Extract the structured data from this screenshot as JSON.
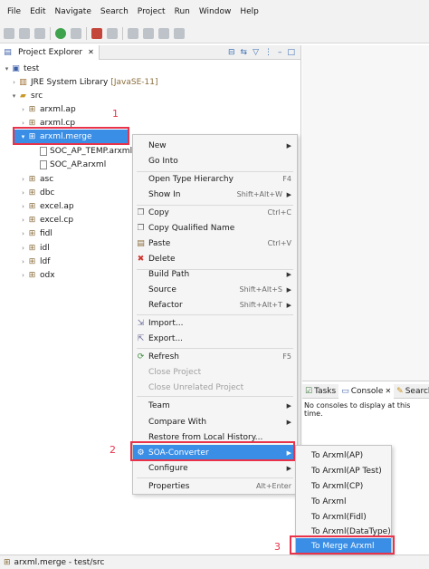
{
  "menu": [
    "File",
    "Edit",
    "Navigate",
    "Search",
    "Project",
    "Run",
    "Window",
    "Help"
  ],
  "explorer": {
    "tab_label": "Project Explorer",
    "close": "✕",
    "tree": [
      {
        "label": "test",
        "icon": "project-folder-icon"
      },
      {
        "label": "JRE System Library",
        "suffix": "[JavaSE-11]",
        "icon": "library-icon"
      },
      {
        "label": "src",
        "icon": "source-folder-icon"
      },
      {
        "label": "arxml.ap",
        "icon": "package-icon"
      },
      {
        "label": "arxml.cp",
        "icon": "package-icon"
      },
      {
        "label": "arxml.merge",
        "icon": "package-icon"
      },
      {
        "label": "SOC_AP_TEMP.arxml",
        "icon": "file-icon"
      },
      {
        "label": "SOC_AP.arxml",
        "icon": "file-icon"
      },
      {
        "label": "asc",
        "icon": "package-icon"
      },
      {
        "label": "dbc",
        "icon": "package-icon"
      },
      {
        "label": "excel.ap",
        "icon": "package-icon"
      },
      {
        "label": "excel.cp",
        "icon": "package-icon"
      },
      {
        "label": "fidl",
        "icon": "package-icon"
      },
      {
        "label": "idl",
        "icon": "package-icon"
      },
      {
        "label": "ldf",
        "icon": "package-icon"
      },
      {
        "label": "odx",
        "icon": "package-icon"
      }
    ]
  },
  "context_menu": [
    {
      "label": "New",
      "submenu": true
    },
    {
      "label": "Go Into"
    },
    {
      "label": "Open Type Hierarchy",
      "accel": "F4"
    },
    {
      "label": "Show In",
      "accel": "Shift+Alt+W",
      "submenu": true
    },
    {
      "label": "Copy",
      "accel": "Ctrl+C"
    },
    {
      "label": "Copy Qualified Name"
    },
    {
      "label": "Paste",
      "accel": "Ctrl+V"
    },
    {
      "label": "Delete"
    },
    {
      "label": "Build Path",
      "submenu": true
    },
    {
      "label": "Source",
      "accel": "Shift+Alt+S",
      "submenu": true
    },
    {
      "label": "Refactor",
      "accel": "Shift+Alt+T",
      "submenu": true
    },
    {
      "label": "Import..."
    },
    {
      "label": "Export..."
    },
    {
      "label": "Refresh",
      "accel": "F5"
    },
    {
      "label": "Close Project",
      "disabled": true
    },
    {
      "label": "Close Unrelated Project",
      "disabled": true
    },
    {
      "label": "Team",
      "submenu": true
    },
    {
      "label": "Compare With",
      "submenu": true
    },
    {
      "label": "Restore from Local History..."
    },
    {
      "label": "SOA-Converter",
      "submenu": true,
      "highlighted": true
    },
    {
      "label": "Configure",
      "submenu": true
    },
    {
      "label": "Properties",
      "accel": "Alt+Enter"
    }
  ],
  "submenu": [
    "To Arxml(AP)",
    "To Arxml(AP Test)",
    "To Arxml(CP)",
    "To Arxml",
    "To Arxml(Fidl)",
    "To Arxml(DataType)",
    "To Merge Arxml"
  ],
  "console": {
    "tabs": [
      "Tasks",
      "Console",
      "Search"
    ],
    "message": "No consoles to display at this time."
  },
  "status": "arxml.merge - test/src",
  "annotations": [
    "1",
    "2",
    "3"
  ],
  "colors": {
    "selection": "#3a8ee6",
    "annotation": "#e8334a"
  }
}
